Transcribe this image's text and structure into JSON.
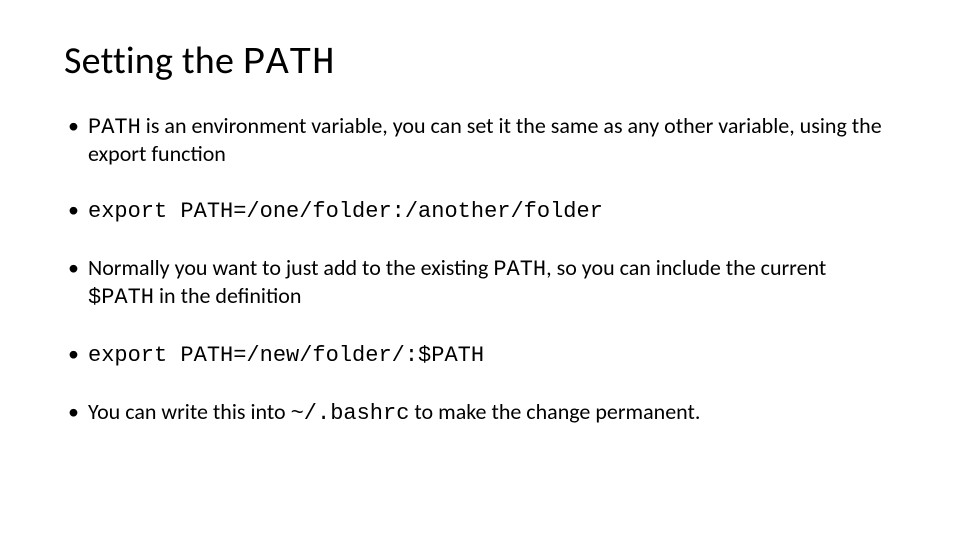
{
  "title": {
    "prefix": "Setting the ",
    "mono": "PATH"
  },
  "bullets": {
    "b1": {
      "mono1": "PATH",
      "t1": " is an environment variable, you can set it the same as any other variable, using the export function"
    },
    "b2": {
      "mono1": "export PATH=/one/folder:/another/folder"
    },
    "b3": {
      "t1": "Normally you want to just add to the existing ",
      "mono1": "PATH",
      "t2": ", so you can include the current ",
      "mono2": "$PATH",
      "t3": " in the definition"
    },
    "b4": {
      "mono1": "export PATH=/new/folder/:$PATH"
    },
    "b5": {
      "t1": "You can write this into ",
      "mono1": "~/.bashrc",
      "t2": " to make the change permanent."
    }
  }
}
